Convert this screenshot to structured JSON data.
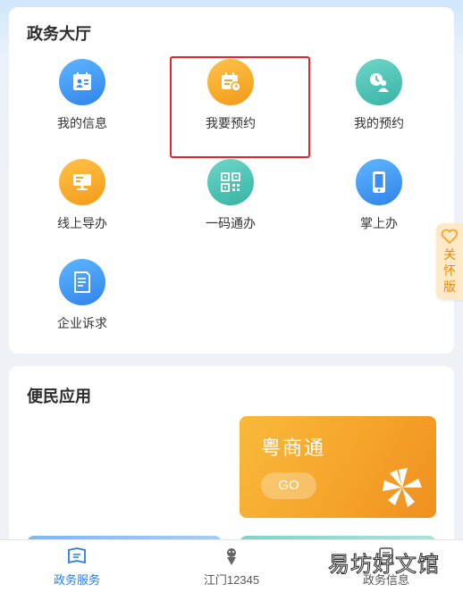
{
  "hall": {
    "title": "政务大厅",
    "items": [
      {
        "label": "我的信息",
        "icon": "id-card-icon",
        "color": "blue"
      },
      {
        "label": "我要预约",
        "icon": "calendar-clock-icon",
        "color": "orange"
      },
      {
        "label": "我的预约",
        "icon": "user-clock-icon",
        "color": "teal"
      },
      {
        "label": "线上导办",
        "icon": "monitor-icon",
        "color": "orange"
      },
      {
        "label": "一码通办",
        "icon": "qr-code-icon",
        "color": "teal"
      },
      {
        "label": "掌上办",
        "icon": "smartphone-icon",
        "color": "blue"
      },
      {
        "label": "企业诉求",
        "icon": "document-icon",
        "color": "blue"
      }
    ]
  },
  "care_tab": {
    "chars": [
      "关",
      "怀",
      "版"
    ],
    "icon": "heart-icon"
  },
  "apps": {
    "title": "便民应用",
    "banner": {
      "title": "粤商通",
      "go_label": "GO",
      "logo": "pinwheel-logo"
    }
  },
  "tabbar": {
    "tabs": [
      {
        "label": "政务服务",
        "icon": "flag-icon",
        "active": true
      },
      {
        "label": "江门12345",
        "icon": "hotline-mascot-icon",
        "active": false
      },
      {
        "label": "政务信息",
        "icon": "info-icon",
        "active": false
      }
    ]
  },
  "watermark": "易坊好文馆",
  "colors": {
    "accent_blue": "#2a7be6",
    "highlight_red": "#e8262a",
    "care_orange": "#f08a00"
  }
}
